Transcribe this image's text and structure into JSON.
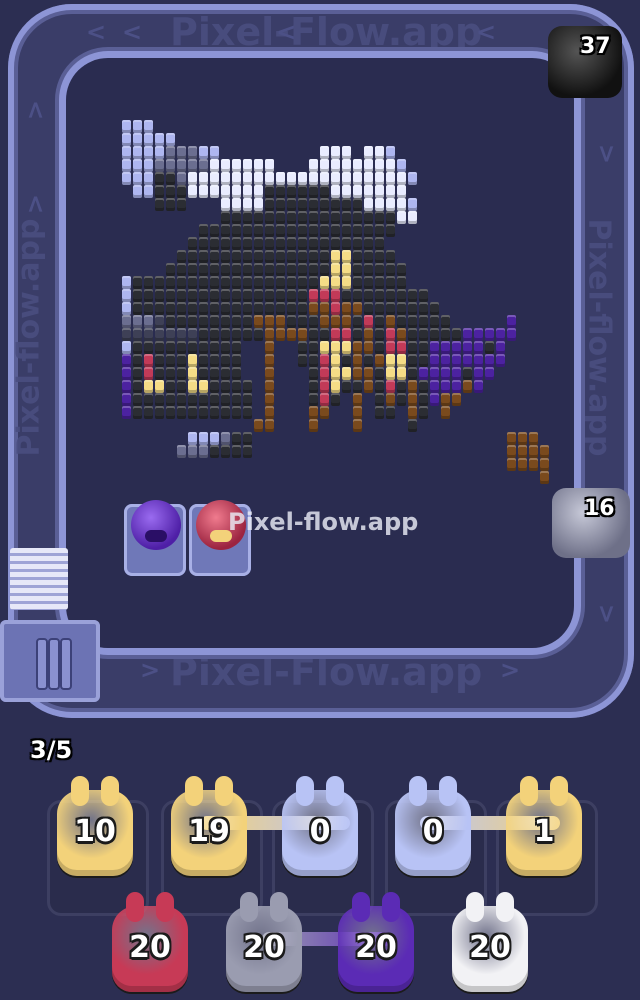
{
  "watermarks": {
    "top": "Pixel-Flow.app",
    "bottom": "Pixel-Flow.app",
    "left": "Pixel-flow.app",
    "right": "Pixel-flow.app",
    "center": "Pixel-flow.app"
  },
  "conveyor": {
    "top_right_counter": "37",
    "right_counter": "16"
  },
  "progress": {
    "label": "3/5"
  },
  "queue_row1": [
    {
      "value": "10",
      "color": "#f3d27a"
    },
    {
      "value": "19",
      "color": "#f3d27a"
    },
    {
      "value": "0",
      "color": "#b8c3f5"
    },
    {
      "value": "0",
      "color": "#b8c3f5"
    },
    {
      "value": "1",
      "color": "#f3d27a"
    }
  ],
  "queue_row2": [
    {
      "value": "20",
      "color": "#c73a56"
    },
    {
      "value": "20",
      "color": "#9a9cb0"
    },
    {
      "value": "20",
      "color": "#5b2bb5"
    },
    {
      "value": "20",
      "color": "#f2f2f5"
    }
  ],
  "pigs": [
    {
      "name": "purple-pig",
      "color": "#6a34c9"
    },
    {
      "name": "red-pig",
      "color": "#c8375a"
    }
  ],
  "colors": {
    "background": "#2c2e52",
    "track": "#3a3d68",
    "rail": "#8d95d6"
  }
}
